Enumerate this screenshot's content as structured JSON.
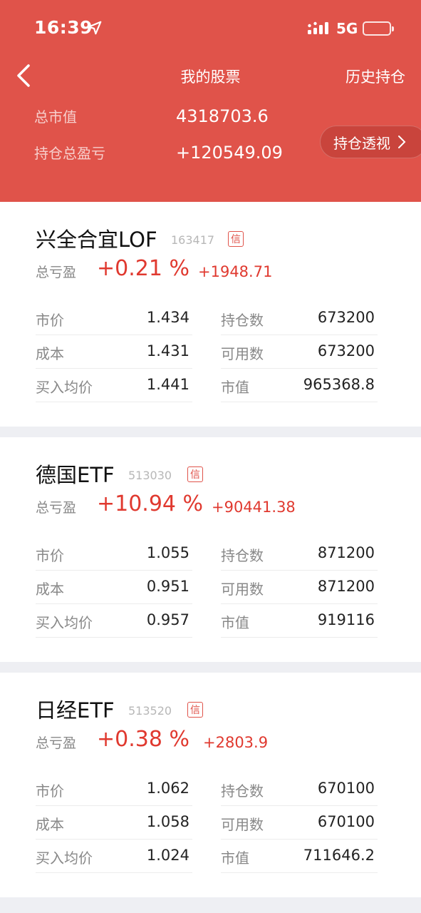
{
  "status_bar": {
    "time": "16:39",
    "network": "5G"
  },
  "nav": {
    "title": "我的股票",
    "history": "历史持仓"
  },
  "summary": {
    "market_value_label": "总市值",
    "market_value": "4318703.6",
    "total_pl_label": "持仓总盈亏",
    "total_pl": "+120549.09",
    "analysis_button": "持仓透视"
  },
  "colors": {
    "brand_red": "#e0534a",
    "gain_red": "#e0392f"
  },
  "stocks": [
    {
      "name": "兴全合宜LOF",
      "code": "163417",
      "badge": "信",
      "pl_label": "总亏盈",
      "pl_pct": "+0.21 %",
      "pl_amount": "+1948.71",
      "price_label": "市价",
      "price": "1.434",
      "hold_label": "持仓数",
      "hold": "673200",
      "cost_label": "成本",
      "cost": "1.431",
      "avail_label": "可用数",
      "avail": "673200",
      "avg_label": "买入均价",
      "avg": "1.441",
      "mv_label": "市值",
      "mv": "965368.8"
    },
    {
      "name": "德国ETF",
      "code": "513030",
      "badge": "信",
      "pl_label": "总亏盈",
      "pl_pct": "+10.94 %",
      "pl_amount": "+90441.38",
      "price_label": "市价",
      "price": "1.055",
      "hold_label": "持仓数",
      "hold": "871200",
      "cost_label": "成本",
      "cost": "0.951",
      "avail_label": "可用数",
      "avail": "871200",
      "avg_label": "买入均价",
      "avg": "0.957",
      "mv_label": "市值",
      "mv": "919116"
    },
    {
      "name": "日经ETF",
      "code": "513520",
      "badge": "信",
      "pl_label": "总亏盈",
      "pl_pct": "+0.38 %",
      "pl_amount": "+2803.9",
      "price_label": "市价",
      "price": "1.062",
      "hold_label": "持仓数",
      "hold": "670100",
      "cost_label": "成本",
      "cost": "1.058",
      "avail_label": "可用数",
      "avail": "670100",
      "avg_label": "买入均价",
      "avg": "1.024",
      "mv_label": "市值",
      "mv": "711646.2"
    }
  ],
  "icons": [
    "location-arrow-icon",
    "signal-icon",
    "battery-icon",
    "back-icon",
    "chevron-right-icon",
    "credit-badge-icon"
  ]
}
